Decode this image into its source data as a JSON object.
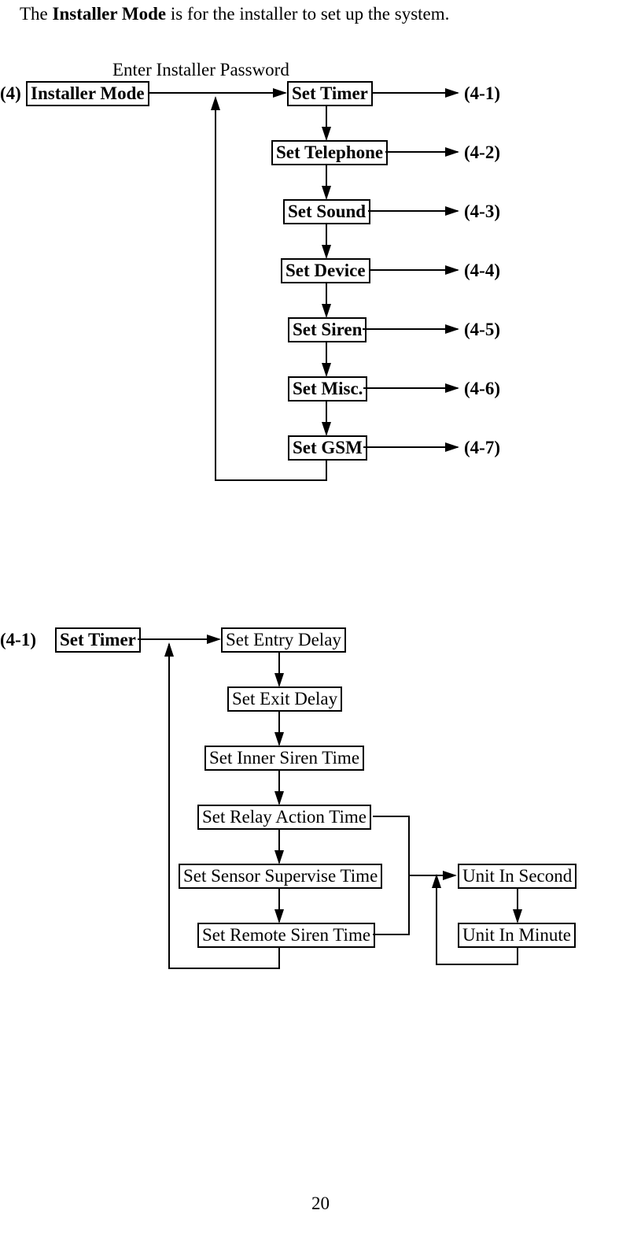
{
  "intro": {
    "pre": "The ",
    "bold": "Installer Mode",
    "post": " is for the installer to set up the system."
  },
  "password_label": "Enter Installer Password",
  "diagram1": {
    "num": "(4)",
    "root": "Installer Mode",
    "items": [
      {
        "label": "Set Timer",
        "ref": "(4-1)"
      },
      {
        "label": "Set Telephone",
        "ref": "(4-2)"
      },
      {
        "label": "Set Sound",
        "ref": "(4-3)"
      },
      {
        "label": "Set Device",
        "ref": "(4-4)"
      },
      {
        "label": "Set Siren",
        "ref": "(4-5)"
      },
      {
        "label": "Set Misc.",
        "ref": "(4-6)"
      },
      {
        "label": "Set GSM",
        "ref": "(4-7)"
      }
    ]
  },
  "diagram2": {
    "num": "(4-1)",
    "root": "Set Timer",
    "items": [
      {
        "label": "Set Entry Delay"
      },
      {
        "label": "Set Exit Delay"
      },
      {
        "label": "Set Inner Siren Time"
      },
      {
        "label": "Set Relay Action Time"
      },
      {
        "label": "Set Sensor Supervise Time"
      },
      {
        "label": "Set Remote Siren Time"
      }
    ],
    "units": {
      "second": "Unit In Second",
      "minute": "Unit In Minute"
    }
  },
  "page_number": "20"
}
